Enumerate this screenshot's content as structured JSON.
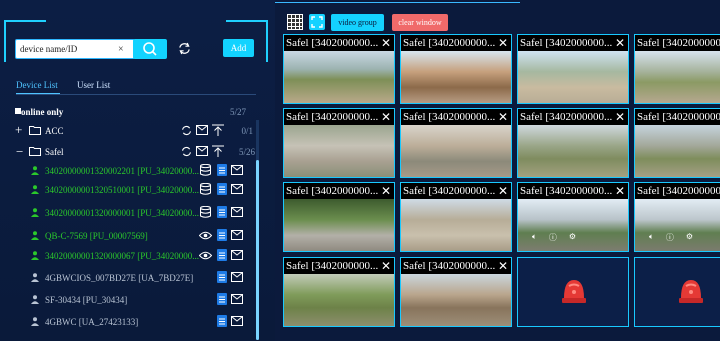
{
  "search": {
    "placeholder": "device name/ID",
    "value": "device name/ID",
    "clear": "×"
  },
  "toolbar_left": {
    "add_label": "Add"
  },
  "tabs": [
    {
      "label": "Device List",
      "active": true
    },
    {
      "label": "User List",
      "active": false
    }
  ],
  "online_only": {
    "label": "online only",
    "count": "5/27"
  },
  "groups": [
    {
      "label": "ACC",
      "count": "0/1",
      "expanded": false
    },
    {
      "label": "Safel",
      "count": "5/26",
      "expanded": true
    }
  ],
  "devices": [
    {
      "label": "34020000001320002201 [PU_34020000...",
      "online": true
    },
    {
      "label": "34020000001320510001 [PU_34020000...",
      "online": true
    },
    {
      "label": "34020000001320000001 [PU_34020000...",
      "online": true
    },
    {
      "label": "QB-C-7569 [PU_00007569]",
      "online": true
    },
    {
      "label": "34020000001320000067 [PU_34020000...",
      "online": true
    },
    {
      "label": "4GBWCIOS_007BD27E [UA_7BD27E]",
      "online": false
    },
    {
      "label": "SF-30434 [PU_30434]",
      "online": false
    },
    {
      "label": "4GBWC [UA_27423133]",
      "online": false
    }
  ],
  "top_toolbar": {
    "video_group": "video group",
    "clear_window": "clear window"
  },
  "cells": [
    {
      "title": "Safel [3402000000..."
    },
    {
      "title": "Safel [3402000000..."
    },
    {
      "title": "Safel [3402000000..."
    },
    {
      "title": "Safel [3402000000..."
    },
    {
      "title": "Safel [3402000000..."
    },
    {
      "title": "Safel [3402000000..."
    },
    {
      "title": "Safel [3402000000..."
    },
    {
      "title": "Safel [3402000000..."
    },
    {
      "title": "Safel [3402000000..."
    },
    {
      "title": "Safel [3402000000..."
    },
    {
      "title": "Safel [3402000000..."
    },
    {
      "title": "Safel [3402000000..."
    },
    {
      "title": "Safel [3402000000..."
    },
    {
      "title": "Safel [3402000000..."
    }
  ],
  "colors": {
    "accent": "#12d3ff",
    "danger": "#f06a6a",
    "online": "#2bc92b",
    "bg": "#0b1a3c"
  }
}
